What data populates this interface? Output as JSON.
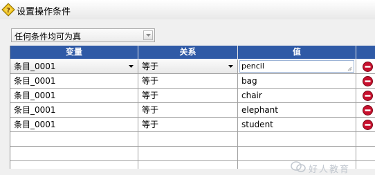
{
  "window": {
    "title": "设置操作条件",
    "icon": "condition-diamond-icon"
  },
  "condition_mode": {
    "selected": "任何条件均可为真"
  },
  "table": {
    "columns": [
      "变量",
      "关系",
      "值",
      ""
    ],
    "rows": [
      {
        "variable": "条目_0001",
        "relation": "等于",
        "value": "pencil"
      },
      {
        "variable": "条目_0001",
        "relation": "等于",
        "value": "bag"
      },
      {
        "variable": "条目_0001",
        "relation": "等于",
        "value": "chair"
      },
      {
        "variable": "条目_0001",
        "relation": "等于",
        "value": "elephant"
      },
      {
        "variable": "条目_0001",
        "relation": "等于",
        "value": "student"
      }
    ],
    "delete_icon": "delete-minus-icon",
    "delete_color": "#c8102e",
    "header_color": "#2f5aa6"
  },
  "watermark": {
    "text": "好人教育"
  }
}
